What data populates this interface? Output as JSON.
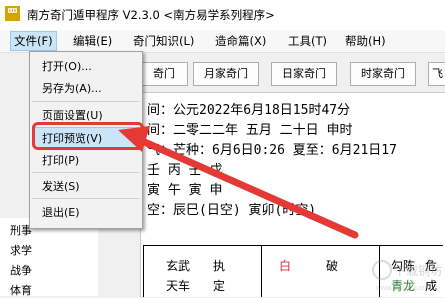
{
  "window": {
    "title": "南方奇门遁甲程序 V2.3.0   <南方易学系列程序>",
    "icon_text": "罒"
  },
  "menubar": [
    {
      "label": "文件(F)"
    },
    {
      "label": "编辑(E)"
    },
    {
      "label": "奇门知识(L)"
    },
    {
      "label": "造命篇(X)"
    },
    {
      "label": "工具(T)"
    },
    {
      "label": "帮助(H)"
    }
  ],
  "toolbar": [
    {
      "label": "奇门"
    },
    {
      "label": "月家奇门"
    },
    {
      "label": "日家奇门"
    },
    {
      "label": "时家奇门"
    },
    {
      "label": "飞"
    }
  ],
  "file_menu": [
    {
      "label": "打开(O)..."
    },
    {
      "label": "另存为(A)..."
    },
    {
      "label": "页面设置(U)"
    },
    {
      "label": "打印预览(V)"
    },
    {
      "label": "打印(P)"
    },
    {
      "label": "发送(S)"
    },
    {
      "label": "退出(E)"
    }
  ],
  "info": [
    "间：公元2022年6月18日15时47分",
    "间：二零二二年 五月 二十日 申时",
    "气：芒种：6月6日0:26  夏至：6月21日17",
    "   壬   丙   壬   戊",
    "   寅   午   寅   申",
    "空：辰巳(日空)  寅卯(时空)"
  ],
  "tree": [
    {
      "label": "刑事"
    },
    {
      "label": "求学"
    },
    {
      "label": "战争"
    },
    {
      "label": "体育"
    }
  ],
  "table": {
    "row1": [
      "玄武",
      "执",
      "白",
      "破",
      "勾陈",
      "危"
    ],
    "row2": [
      "天车",
      "定",
      "",
      "",
      "",
      "青龙",
      "成"
    ]
  },
  "watermark": {
    "text": "下载铜坊",
    "sub": "www.downza.cn"
  },
  "colors": {
    "highlight": "#cce4f7",
    "annotation_red": "#e53935",
    "accent_red": "#d32f2f"
  }
}
